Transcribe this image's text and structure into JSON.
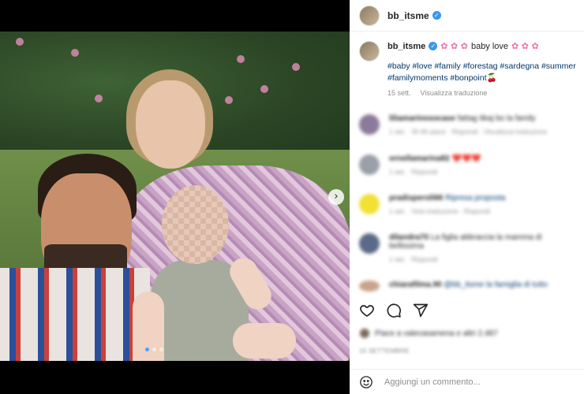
{
  "post": {
    "username": "bb_itsme",
    "caption_text": "baby love",
    "caption_emoji": "✿ ✿ ✿",
    "hashtags": "#baby #love #family #forestag #sardegna #summer #familymoments #bonpoint🍒",
    "date": "15 sett.",
    "translate_label": "Visualizza traduzione"
  },
  "media": {
    "next_icon": "chevron-right-icon",
    "next_glyph": "›",
    "dots_total": 3,
    "active_dot": 0
  },
  "comments": [
    {
      "user": "liliamarinosocase",
      "text": "fattag tikaj bo la family",
      "meta": "1 set. · 35 Mi piace · Rispondi · Visualizza traduzione",
      "avatar_color": "#8c7a9a"
    },
    {
      "user": "ornellamarina82",
      "text": "❤️❤️❤️",
      "meta": "1 set. · Rispondi",
      "avatar_color": "#9aa0a8"
    },
    {
      "user": "pradisperoli66",
      "text": "Ripresa proposta",
      "meta": "1 set. · Vota traduzione · Rispondi",
      "avatar_color": "#f2e033"
    },
    {
      "user": "dilandra70",
      "text": "La figlia abbraccia la mamma di bellissima",
      "meta": "1 set. · Rispondi",
      "avatar_color": "#5a6a88"
    },
    {
      "user": "chiarafilma.90",
      "text": "@bb_itsme la famiglia di tutto",
      "meta": "",
      "avatar_color": "#c9a38a"
    }
  ],
  "liked_by": "Piace a valecasamena e altri 2.487",
  "liked_date": "15 SETTEMBRE",
  "add_comment": {
    "placeholder": "Aggiungi un commento..."
  },
  "colors": {
    "link": "#00376b",
    "verified": "#3897f0",
    "muted": "#8e8e8e",
    "active_dot": "#4aa3ff"
  }
}
